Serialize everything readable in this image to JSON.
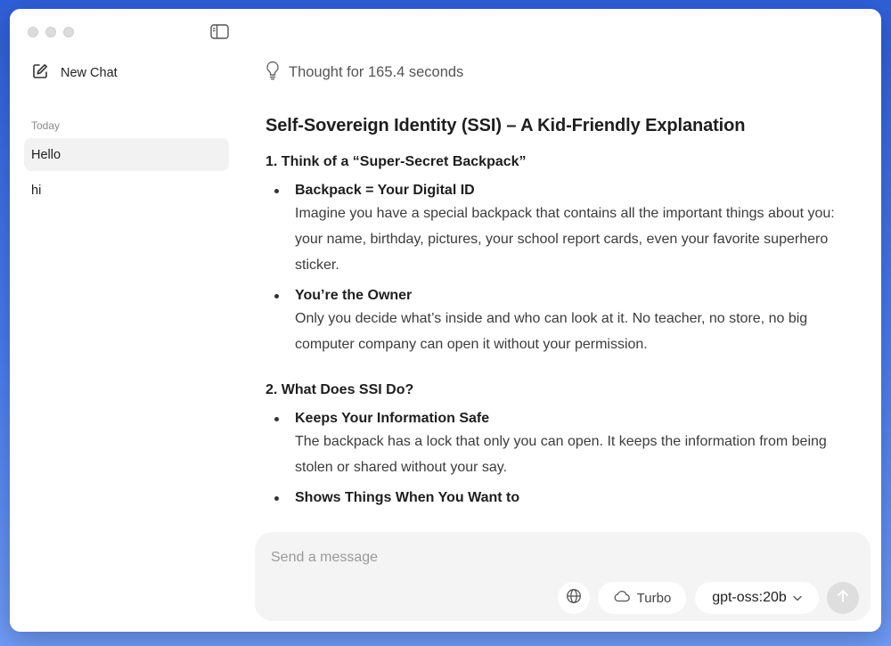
{
  "sidebar": {
    "new_chat_label": "New Chat",
    "section_label": "Today",
    "chats": [
      "Hello",
      "hi"
    ]
  },
  "thought": {
    "text": "Thought for 165.4 seconds"
  },
  "article": {
    "title": "Self-Sovereign Identity (SSI) – A Kid-Friendly Explanation",
    "sections": [
      {
        "heading": "1. Think of a “Super-Secret Backpack”",
        "bullets": [
          {
            "head": "Backpack = Your Digital ID",
            "body": "Imagine you have a special backpack that contains all the important things about you: your name, birthday, pictures, your school report cards, even your favorite superhero sticker."
          },
          {
            "head": "You’re the Owner",
            "body": "Only you decide what’s inside and who can look at it. No teacher, no store, no big computer company can open it without your permission."
          }
        ]
      },
      {
        "heading": "2. What Does SSI Do?",
        "bullets": [
          {
            "head": "Keeps Your Information Safe",
            "body": "The backpack has a lock that only you can open. It keeps the information from being stolen or shared without your say."
          },
          {
            "head": "Shows Things When You Want to",
            "body": ""
          }
        ]
      }
    ]
  },
  "composer": {
    "placeholder": "Send a message",
    "turbo_label": "Turbo",
    "model_label": "gpt-oss:20b"
  },
  "colors": {
    "window_bg": "#ffffff",
    "active_chat_bg": "#f2f2f2",
    "composer_bg": "#f4f4f4",
    "send_button_bg": "#dedede"
  },
  "icons": [
    "sidebar-toggle-icon",
    "compose-icon",
    "lightbulb-icon",
    "globe-icon",
    "cloud-icon",
    "chevron-down-icon",
    "arrow-up-icon"
  ]
}
